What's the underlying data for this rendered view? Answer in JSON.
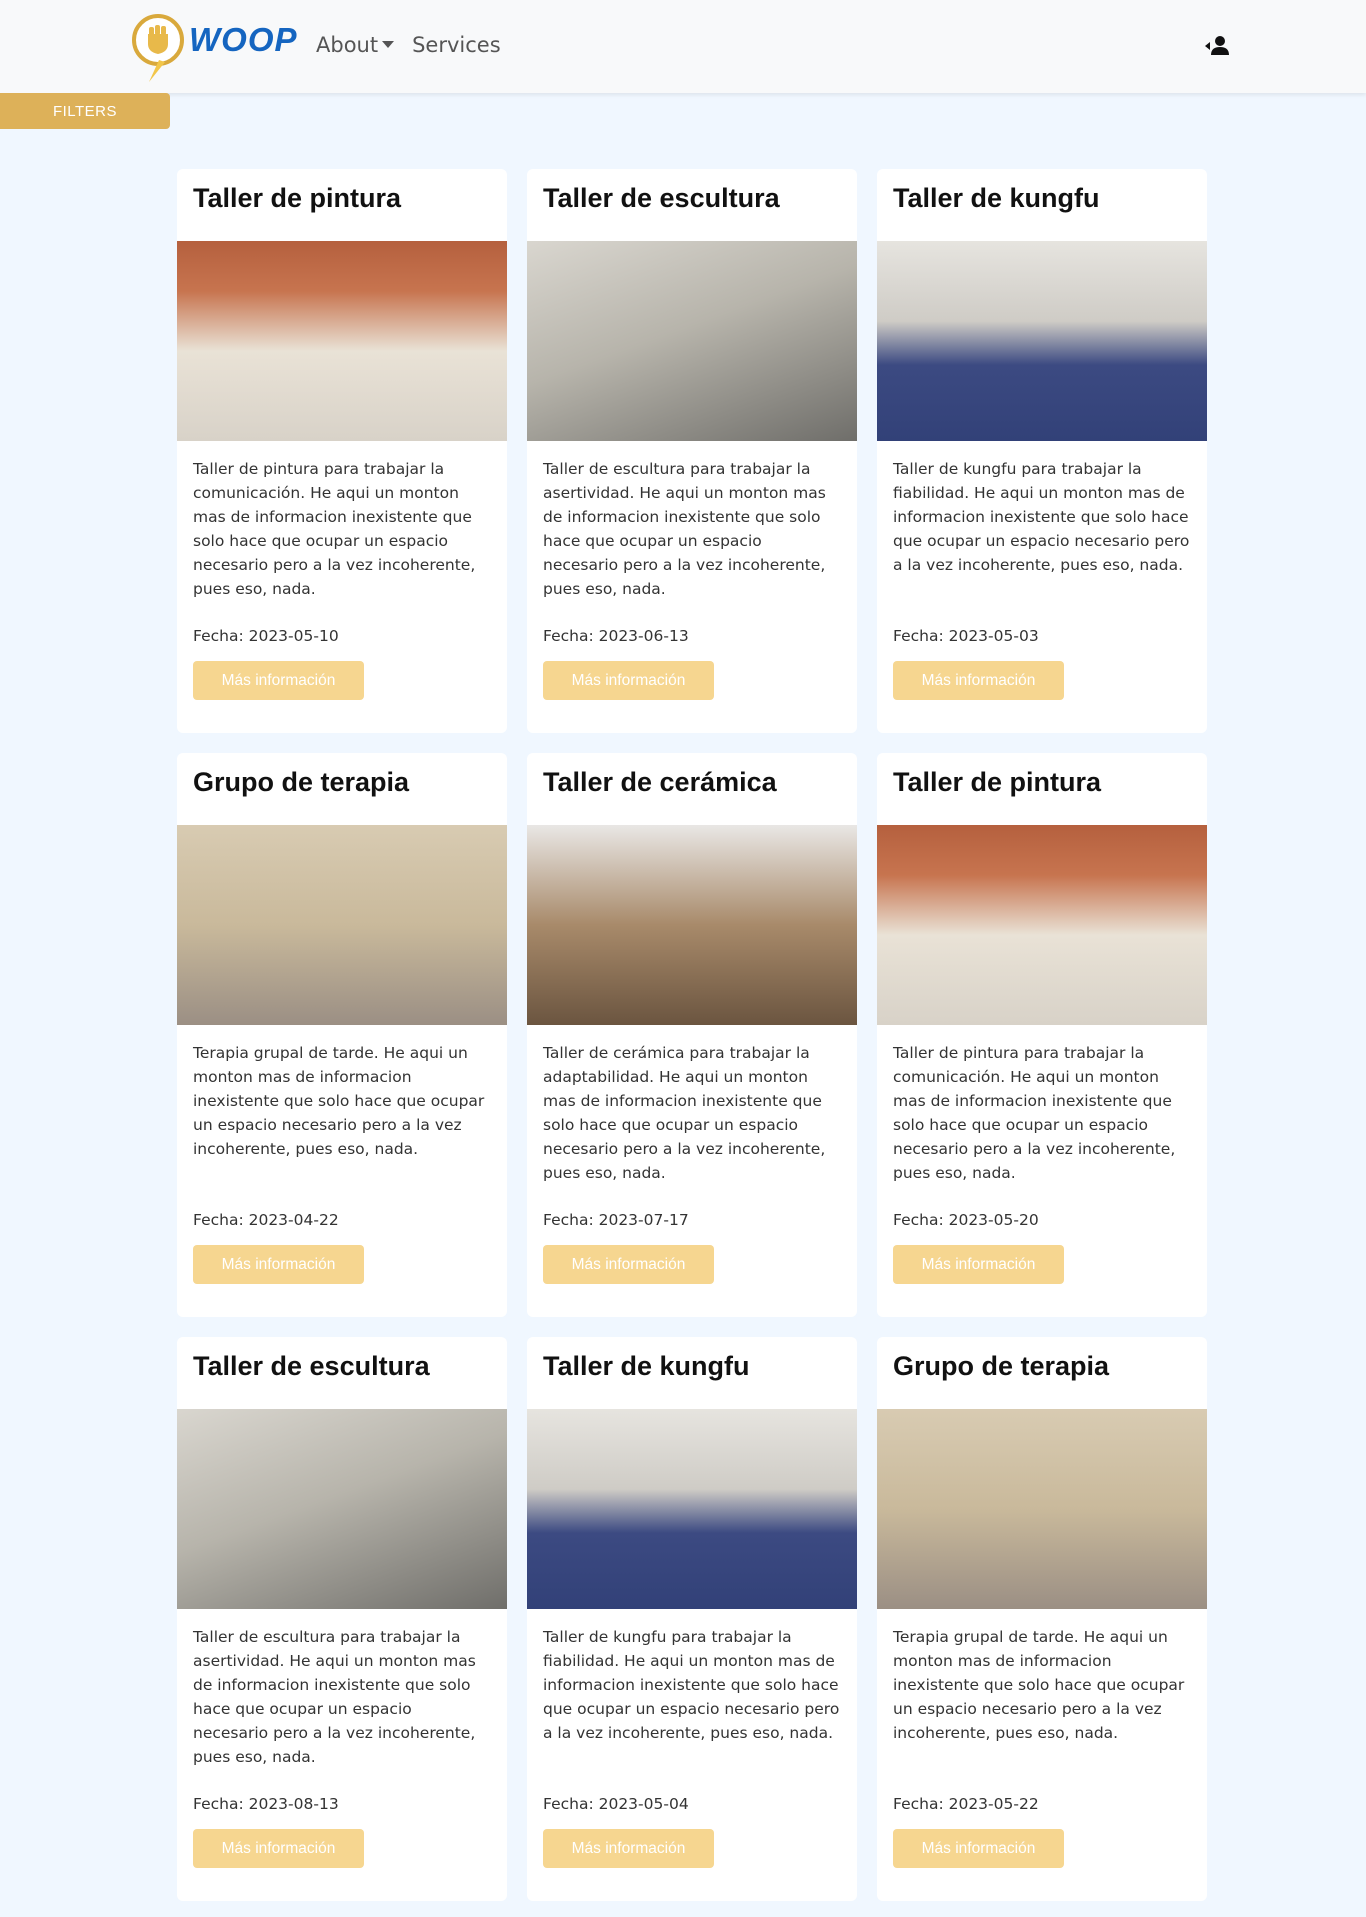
{
  "navbar": {
    "brand": "WOOP",
    "links": [
      {
        "label": "About",
        "has_dropdown": true
      },
      {
        "label": "Services",
        "has_dropdown": false
      }
    ],
    "user_icon": "user-login-icon"
  },
  "filters": {
    "label": "FILTERS"
  },
  "colors": {
    "accent": "#ddb159",
    "button_light": "#f6d690",
    "brand_blue": "#1565c0",
    "page_bg": "#f0f7ff"
  },
  "cards": [
    {
      "title": "Taller de pintura",
      "image": "painting-class-photo",
      "description": "Taller de pintura para trabajar la comunicación. He aqui un monton mas de informacion inexistente que solo hace que ocupar un espacio necesario pero a la vez incoherente, pues eso, nada.",
      "date": "Fecha: 2023-05-10",
      "button": "Más información"
    },
    {
      "title": "Taller de escultura",
      "image": "sculpture-class-photo",
      "description": "Taller de escultura para trabajar la asertividad. He aqui un monton mas de informacion inexistente que solo hace que ocupar un espacio necesario pero a la vez incoherente, pues eso, nada.",
      "date": "Fecha: 2023-06-13",
      "button": "Más información"
    },
    {
      "title": "Taller de kungfu",
      "image": "kungfu-class-photo",
      "description": "Taller de kungfu para trabajar la fiabilidad. He aqui un monton mas de informacion inexistente que solo hace que ocupar un espacio necesario pero a la vez incoherente, pues eso, nada.",
      "date": "Fecha: 2023-05-03",
      "button": "Más información"
    },
    {
      "title": "Grupo de terapia",
      "image": "therapy-group-photo",
      "description": "Terapia grupal de tarde. He aqui un monton mas de informacion inexistente que solo hace que ocupar un espacio necesario pero a la vez incoherente, pues eso, nada.",
      "date": "Fecha: 2023-04-22",
      "button": "Más información"
    },
    {
      "title": "Taller de cerámica",
      "image": "ceramics-class-photo",
      "description": "Taller de cerámica para trabajar la adaptabilidad. He aqui un monton mas de informacion inexistente que solo hace que ocupar un espacio necesario pero a la vez incoherente, pues eso, nada.",
      "date": "Fecha: 2023-07-17",
      "button": "Más información"
    },
    {
      "title": "Taller de pintura",
      "image": "painting-class-photo",
      "description": "Taller de pintura para trabajar la comunicación. He aqui un monton mas de informacion inexistente que solo hace que ocupar un espacio necesario pero a la vez incoherente, pues eso, nada.",
      "date": "Fecha: 2023-05-20",
      "button": "Más información"
    },
    {
      "title": "Taller de escultura",
      "image": "sculpture-class-photo",
      "description": "Taller de escultura para trabajar la asertividad. He aqui un monton mas de informacion inexistente que solo hace que ocupar un espacio necesario pero a la vez incoherente, pues eso, nada.",
      "date": "Fecha: 2023-08-13",
      "button": "Más información"
    },
    {
      "title": "Taller de kungfu",
      "image": "kungfu-class-photo",
      "description": "Taller de kungfu para trabajar la fiabilidad. He aqui un monton mas de informacion inexistente que solo hace que ocupar un espacio necesario pero a la vez incoherente, pues eso, nada.",
      "date": "Fecha: 2023-05-04",
      "button": "Más información"
    },
    {
      "title": "Grupo de terapia",
      "image": "therapy-group-photo",
      "description": "Terapia grupal de tarde. He aqui un monton mas de informacion inexistente que solo hace que ocupar un espacio necesario pero a la vez incoherente, pues eso, nada.",
      "date": "Fecha: 2023-05-22",
      "button": "Más información"
    }
  ]
}
